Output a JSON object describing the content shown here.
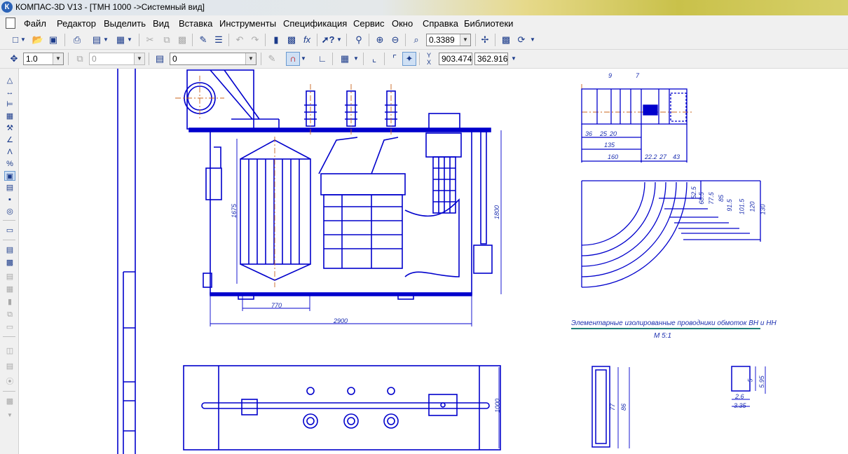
{
  "window": {
    "title": "КОМПАС-3D V13 - [ТМН 1000 ->Системный вид]",
    "app_icon": "К"
  },
  "menu": [
    "Файл",
    "Редактор",
    "Выделить",
    "Вид",
    "Вставка",
    "Инструменты",
    "Спецификация",
    "Сервис",
    "Окно",
    "Справка",
    "Библиотеки"
  ],
  "toolbar1": {
    "zoom_value": "0.3389"
  },
  "toolbar2": {
    "step_value": "1.0",
    "layer_value": "0",
    "style_value": "0",
    "y_label": "Y",
    "x_label": "X",
    "coord_x": "903.474",
    "coord_y": "362.916"
  },
  "drawing": {
    "dims": {
      "width_2900": "2900",
      "width_770": "770",
      "height_1675": "1675",
      "height_1800": "1800",
      "plan_1000": "1000",
      "d36": "36",
      "d25": "25",
      "d20": "20",
      "d135": "135",
      "d160": "160",
      "d22_2": "22.2",
      "d27": "27",
      "d43": "43",
      "d9": "9",
      "d7": "7",
      "r52_5": "52.5",
      "r68_5": "68.5",
      "r77_5": "77.5",
      "r85": "85",
      "r91_5": "91.5",
      "r101_5": "101.5",
      "r120": "120",
      "r130": "130",
      "d77": "77",
      "d86": "86",
      "d5": "5",
      "d5_95": "5.95",
      "d2_6": "2.6",
      "d3_35": "3.35"
    },
    "caption": "Элементарные изолированные проводники обмоток ВН и НН",
    "scale": "М 5:1"
  },
  "colors": {
    "line": "#0000cc",
    "center": "#c8641e",
    "caption_line": "#1f7f7a"
  }
}
